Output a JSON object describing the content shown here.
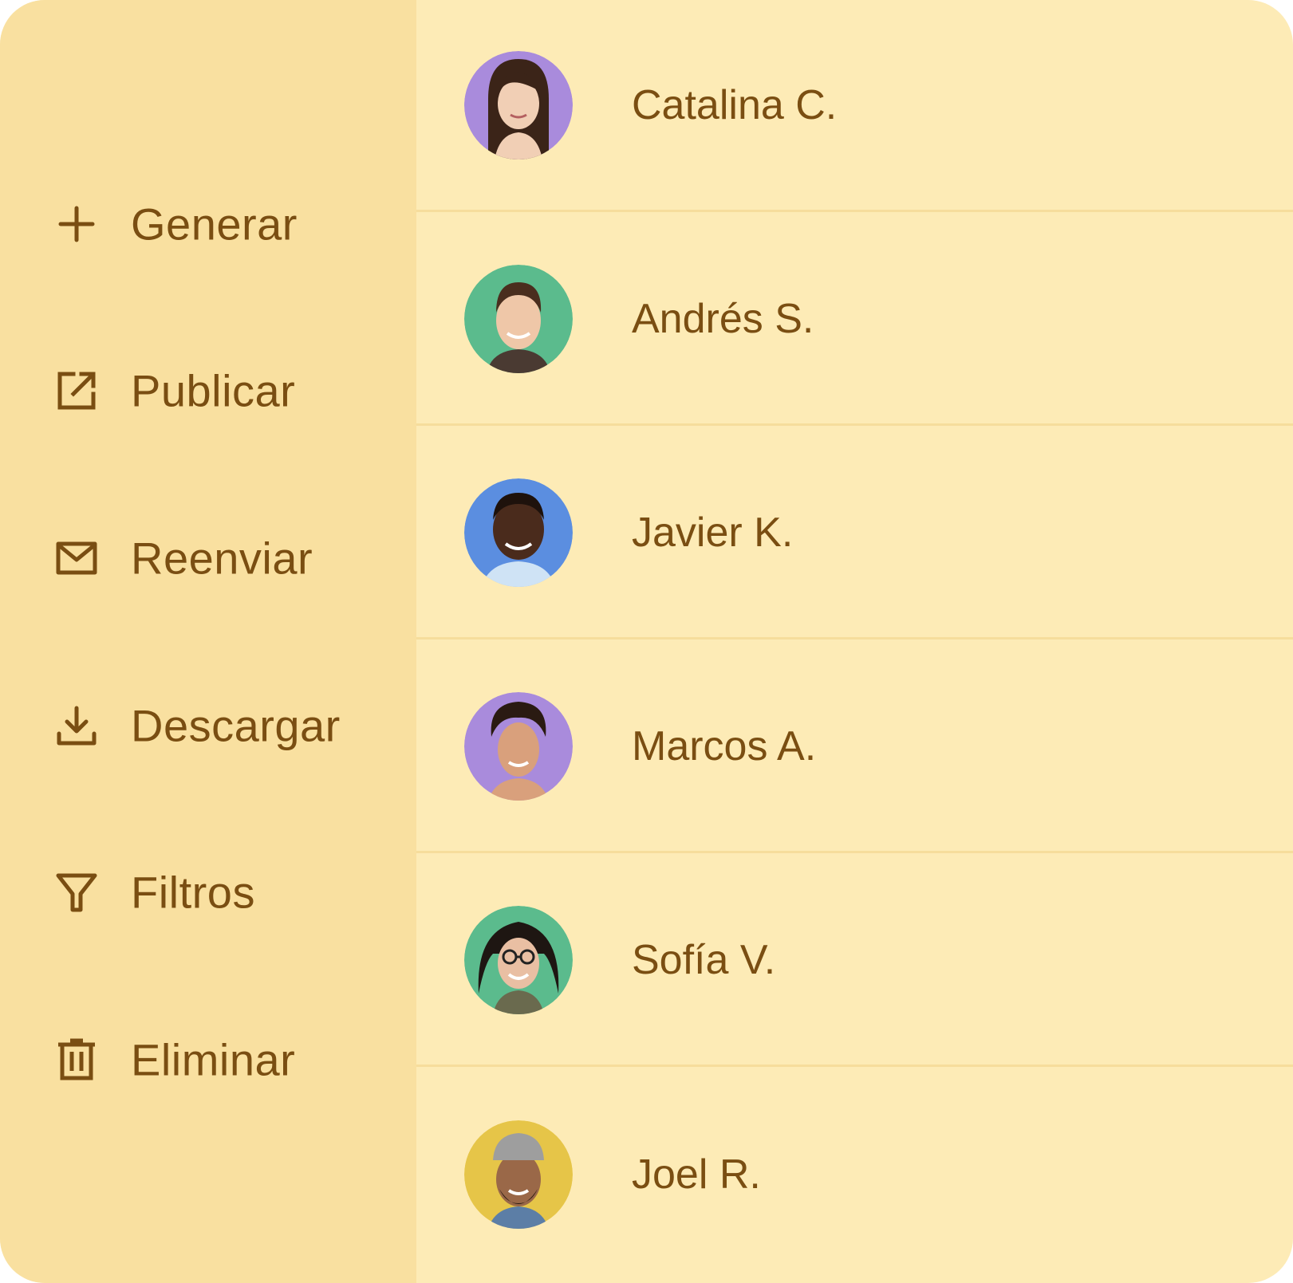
{
  "colors": {
    "card_bg": "#FDEBB6",
    "sidebar_bg": "#F9E0A0",
    "text": "#7A4E12",
    "divider": "#F6DD9C"
  },
  "menu": {
    "items": [
      {
        "label": "Generar",
        "icon": "plus-icon"
      },
      {
        "label": "Publicar",
        "icon": "external-link-icon"
      },
      {
        "label": "Reenviar",
        "icon": "mail-icon"
      },
      {
        "label": "Descargar",
        "icon": "download-icon"
      },
      {
        "label": "Filtros",
        "icon": "filter-icon"
      },
      {
        "label": "Eliminar",
        "icon": "trash-icon"
      }
    ]
  },
  "people": [
    {
      "name": "Catalina C.",
      "avatar_bg": "#A98BDC"
    },
    {
      "name": "Andrés S.",
      "avatar_bg": "#5BBB8D"
    },
    {
      "name": "Javier K.",
      "avatar_bg": "#5B8EE0"
    },
    {
      "name": "Marcos A.",
      "avatar_bg": "#A98BDC"
    },
    {
      "name": "Sofía V.",
      "avatar_bg": "#5BBB8D"
    },
    {
      "name": "Joel R.",
      "avatar_bg": "#E6C548"
    }
  ]
}
